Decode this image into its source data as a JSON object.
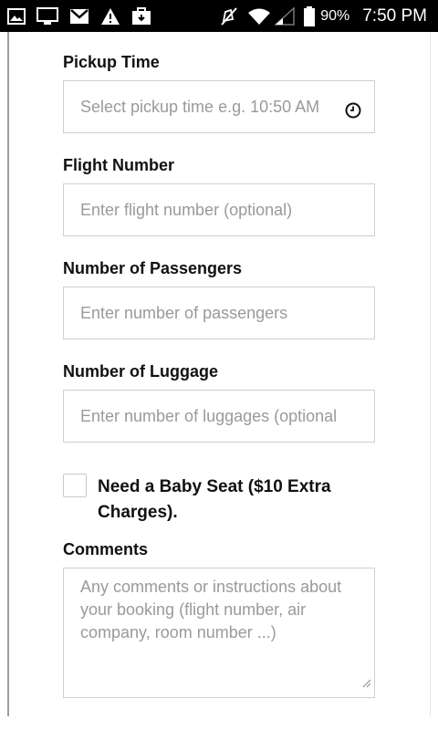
{
  "status_bar": {
    "battery_percent": "90%",
    "time": "7:50 PM",
    "left_icons": [
      "image-icon",
      "cast-icon",
      "gmail-icon",
      "warning-icon",
      "clipboard-icon"
    ],
    "right_icons": [
      "mute-icon",
      "wifi-icon",
      "signal-icon",
      "battery-icon"
    ]
  },
  "form": {
    "pickup_time": {
      "label": "Pickup Time",
      "placeholder": "Select pickup time e.g. 10:50 AM"
    },
    "flight_number": {
      "label": "Flight Number",
      "placeholder": "Enter flight number (optional)"
    },
    "passengers": {
      "label": "Number of Passengers",
      "placeholder": "Enter number of passengers"
    },
    "luggage": {
      "label": "Number of Luggage",
      "placeholder": "Enter number of luggages (optional"
    },
    "baby_seat": {
      "label": "Need a Baby Seat ($10 Extra Charges).",
      "checked": false
    },
    "comments": {
      "label": "Comments",
      "placeholder": "Any comments or instructions about your booking (flight number, air company, room number ...)"
    }
  }
}
